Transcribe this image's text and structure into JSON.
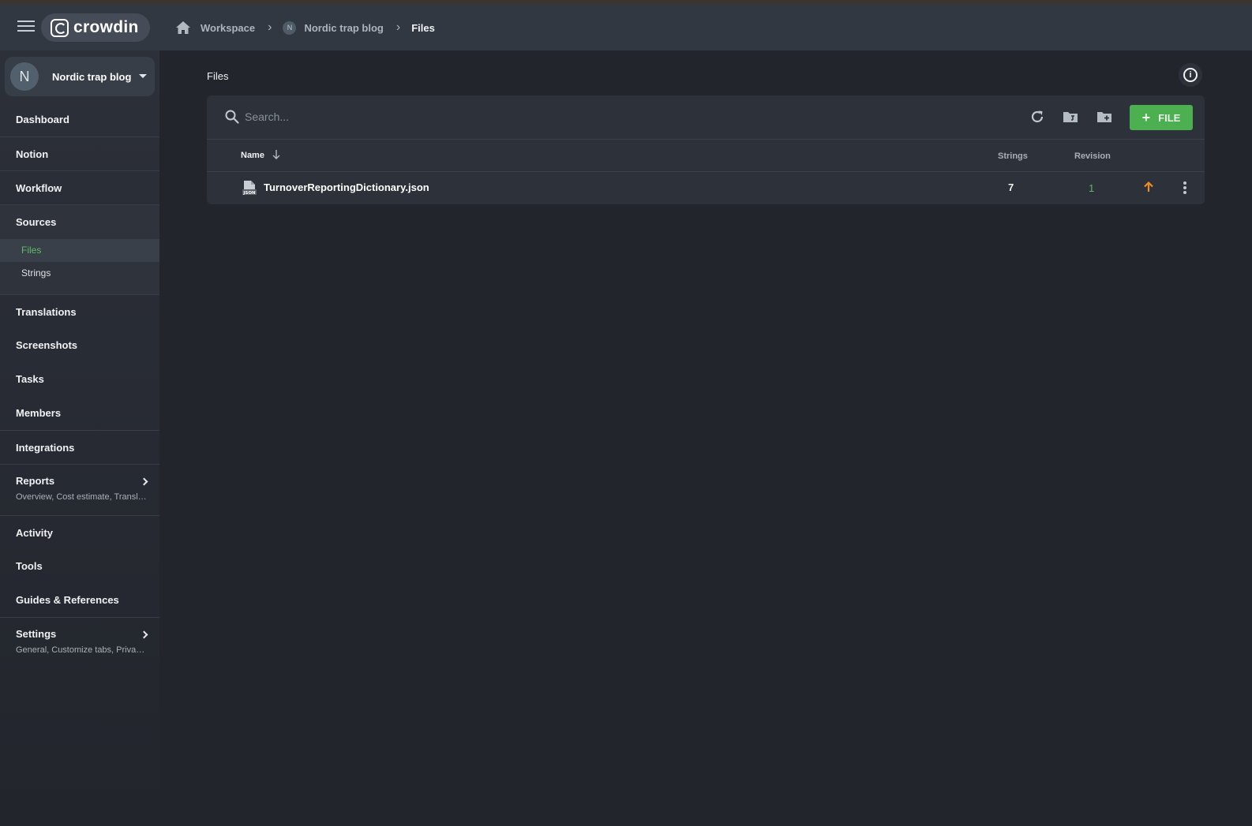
{
  "app": {
    "brand": "crowdin"
  },
  "breadcrumb": {
    "workspace": "Workspace",
    "project_initial": "N",
    "project": "Nordic trap blog",
    "current": "Files"
  },
  "project_switcher": {
    "initial": "N",
    "name": "Nordic trap blog"
  },
  "sidebar": {
    "items": [
      {
        "label": "Dashboard"
      },
      {
        "label": "Notion"
      },
      {
        "label": "Workflow"
      },
      {
        "label": "Sources",
        "expanded": true,
        "children": [
          {
            "label": "Files",
            "active": true
          },
          {
            "label": "Strings"
          }
        ]
      },
      {
        "label": "Translations"
      },
      {
        "label": "Screenshots"
      },
      {
        "label": "Tasks"
      },
      {
        "label": "Members"
      },
      {
        "label": "Integrations"
      },
      {
        "label": "Reports",
        "subtitle": "Overview, Cost estimate, Transl…"
      },
      {
        "label": "Activity"
      },
      {
        "label": "Tools"
      },
      {
        "label": "Guides & References"
      },
      {
        "label": "Settings",
        "subtitle": "General, Customize tabs, Priva…"
      }
    ]
  },
  "main": {
    "title": "Files",
    "search": {
      "placeholder": "Search...",
      "value": ""
    },
    "add_file_label": "FILE",
    "columns": {
      "name": "Name",
      "strings": "Strings",
      "revision": "Revision"
    },
    "files": [
      {
        "name": "TurnoverReportingDictionary.json",
        "type": "JSON",
        "strings": "7",
        "revision": "1"
      }
    ]
  },
  "colors": {
    "accent": "#4caf50",
    "active_nav": "#5dbb63",
    "revision": "#5cb85c",
    "update_arrow": "#f08a24",
    "background": "#22252c",
    "header": "#323841"
  },
  "icons": [
    "menu-icon",
    "home-icon",
    "chevron-right-icon",
    "caret-down-icon",
    "info-icon",
    "search-icon",
    "refresh-icon",
    "new-branch-icon",
    "new-folder-icon",
    "plus-icon",
    "sort-arrow-down-icon",
    "json-file-icon",
    "update-arrow-icon",
    "more-vertical-icon"
  ]
}
